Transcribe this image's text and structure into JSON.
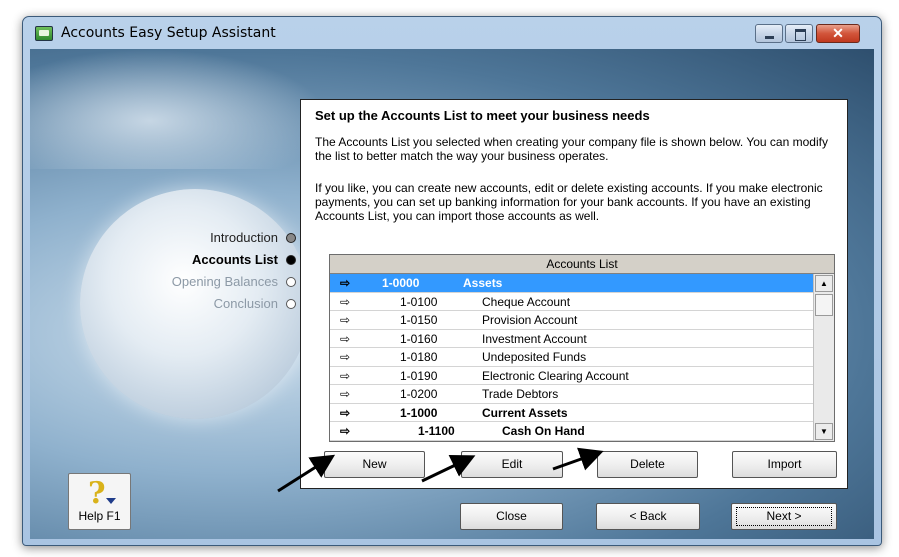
{
  "window": {
    "title": "Accounts Easy Setup Assistant",
    "close_glyph": "✕"
  },
  "steps": [
    {
      "label": "Introduction",
      "state": "done"
    },
    {
      "label": "Accounts List",
      "state": "current"
    },
    {
      "label": "Opening Balances",
      "state": "pending"
    },
    {
      "label": "Conclusion",
      "state": "pending"
    }
  ],
  "help": {
    "glyph": "?",
    "label": "Help F1"
  },
  "panel": {
    "heading": "Set up the Accounts List to meet your business needs",
    "para1": "The Accounts List you selected when creating your company file is shown below. You can modify the list to better match the way your business operates.",
    "para2": "If you like, you can create new accounts, edit or delete existing accounts.  If you make electronic payments, you can set up banking information for your bank accounts. If you have an existing Accounts List, you can import those accounts as well."
  },
  "accounts_list": {
    "header": "Accounts List",
    "arrow_glyph": "⇨",
    "rows": [
      {
        "number": "1-0000",
        "name": "Assets",
        "level": 0,
        "bold": true,
        "selected": true
      },
      {
        "number": "1-0100",
        "name": "Cheque Account",
        "level": 1,
        "bold": false,
        "selected": false
      },
      {
        "number": "1-0150",
        "name": "Provision Account",
        "level": 1,
        "bold": false,
        "selected": false
      },
      {
        "number": "1-0160",
        "name": "Investment Account",
        "level": 1,
        "bold": false,
        "selected": false
      },
      {
        "number": "1-0180",
        "name": "Undeposited Funds",
        "level": 1,
        "bold": false,
        "selected": false
      },
      {
        "number": "1-0190",
        "name": "Electronic Clearing Account",
        "level": 1,
        "bold": false,
        "selected": false
      },
      {
        "number": "1-0200",
        "name": "Trade Debtors",
        "level": 1,
        "bold": false,
        "selected": false
      },
      {
        "number": "1-1000",
        "name": "Current Assets",
        "level": 1,
        "bold": true,
        "selected": false
      },
      {
        "number": "1-1100",
        "name": "Cash On Hand",
        "level": 2,
        "bold": true,
        "selected": false
      }
    ],
    "scroll_up_glyph": "▲",
    "scroll_down_glyph": "▼"
  },
  "list_buttons": {
    "new": "New",
    "edit": "Edit",
    "delete": "Delete",
    "import": "Import"
  },
  "nav_buttons": {
    "close": "Close",
    "back": "< Back",
    "next": "Next >"
  }
}
